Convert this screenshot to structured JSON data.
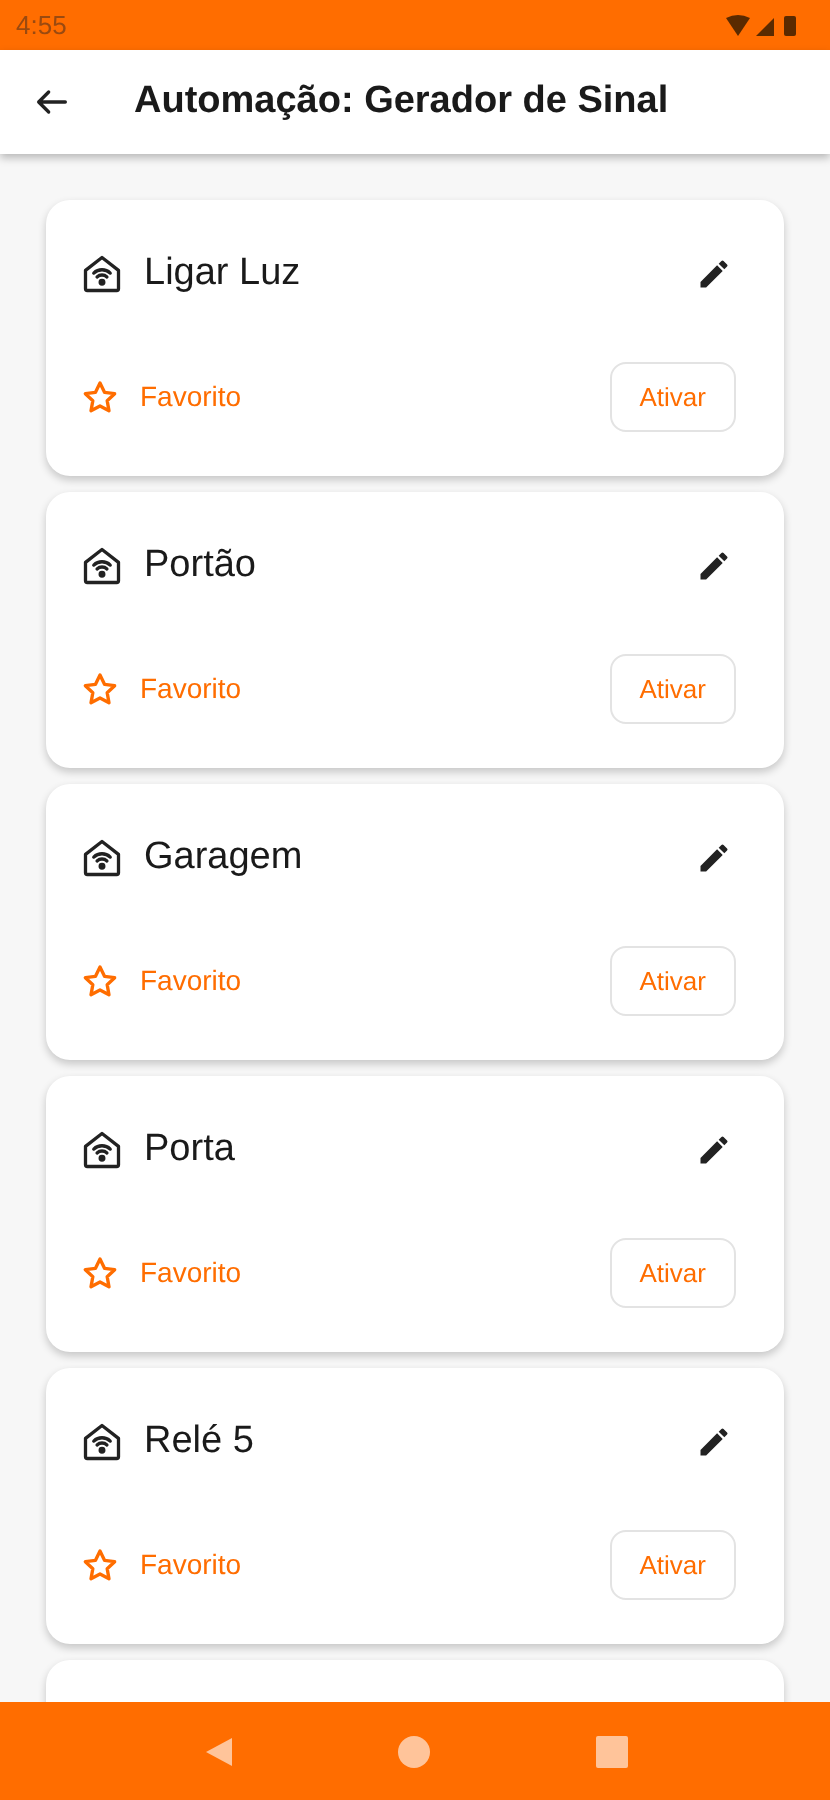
{
  "status_bar": {
    "time": "4:55"
  },
  "app_bar": {
    "title": "Automação: Gerador de Sinal"
  },
  "automations": [
    {
      "name": "Ligar Luz",
      "favorite": false,
      "favorite_label": "Favorito",
      "action": "Ativar"
    },
    {
      "name": "Portão",
      "favorite": false,
      "favorite_label": "Favorito",
      "action": "Ativar"
    },
    {
      "name": "Garagem",
      "favorite": false,
      "favorite_label": "Favorito",
      "action": "Ativar"
    },
    {
      "name": "Porta",
      "favorite": false,
      "favorite_label": "Favorito",
      "action": "Ativar"
    },
    {
      "name": "Relé 5",
      "favorite": false,
      "favorite_label": "Favorito",
      "action": "Ativar"
    }
  ]
}
